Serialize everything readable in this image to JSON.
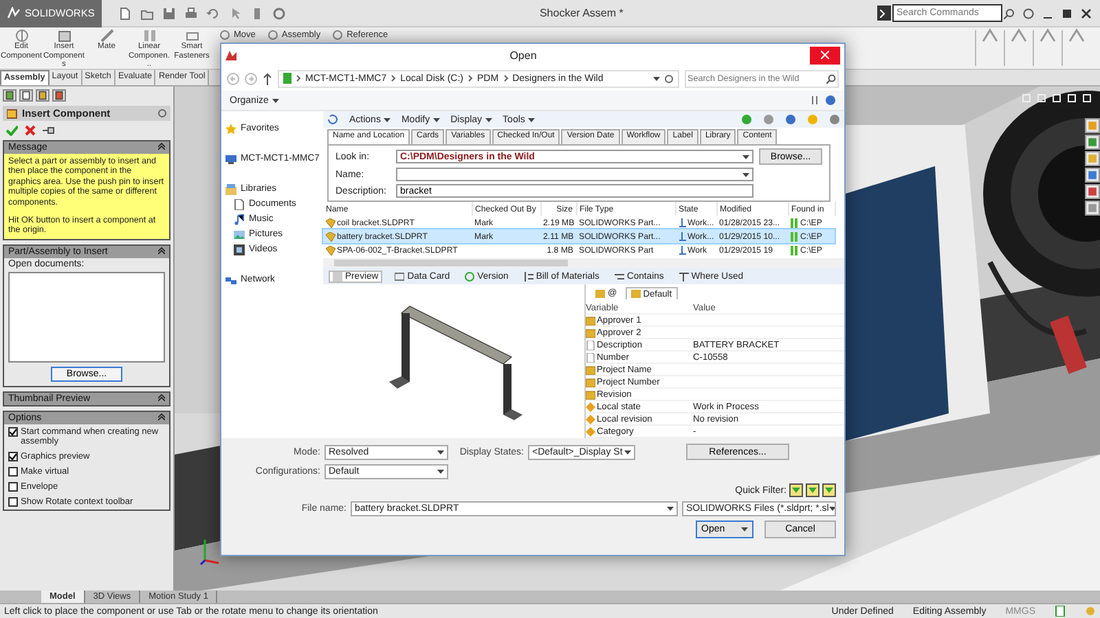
{
  "app": {
    "logo": "SOLIDWORKS",
    "document_title": "Shocker Assem *",
    "search": {
      "placeholder": "Search Commands"
    }
  },
  "ribbon": {
    "buttons": [
      {
        "label": "Edit Component"
      },
      {
        "label": "Insert Components"
      },
      {
        "label": "Mate"
      },
      {
        "label": "Linear Componen..."
      },
      {
        "label": "Smart Fasteners"
      }
    ],
    "top_buttons": [
      {
        "label": "Move"
      },
      {
        "label": "Assembly"
      },
      {
        "label": "Reference"
      }
    ],
    "tabs": [
      {
        "label": "Assembly",
        "selected": true
      },
      {
        "label": "Layout",
        "selected": false
      },
      {
        "label": "Sketch",
        "selected": false
      },
      {
        "label": "Evaluate",
        "selected": false
      },
      {
        "label": "Render Tool",
        "selected": false
      }
    ]
  },
  "property_manager": {
    "title": "Insert Component",
    "message": {
      "title": "Message",
      "paragraphs": [
        "Select a part or assembly to insert and then place the component in the graphics area. Use the push pin to insert multiple copies of the same or different components.",
        "Hit OK button to insert a component at the origin."
      ]
    },
    "part_to_insert": {
      "title": "Part/Assembly to Insert",
      "label": "Open documents:",
      "browse": "Browse..."
    },
    "thumbnail_preview": {
      "title": "Thumbnail Preview"
    },
    "options": {
      "title": "Options",
      "items": [
        {
          "label": "Start command when creating new assembly",
          "checked": true
        },
        {
          "label": "Graphics preview",
          "checked": true
        },
        {
          "label": "Make virtual",
          "checked": false
        },
        {
          "label": "Envelope",
          "checked": false
        },
        {
          "label": "Show Rotate context toolbar",
          "checked": false
        }
      ]
    }
  },
  "bottom_tabs": [
    {
      "label": "Model",
      "selected": true
    },
    {
      "label": "3D Views",
      "selected": false
    },
    {
      "label": "Motion Study 1",
      "selected": false
    }
  ],
  "status_bar": {
    "hint": "Left click to place the component or use Tab or the rotate menu to change its orientation",
    "state": "Under Defined",
    "mode": "Editing Assembly",
    "units": "MMGS"
  },
  "dialog": {
    "title": "Open",
    "path": [
      "MCT-MCT1-MMC7",
      "Local Disk (C:)",
      "PDM",
      "Designers in the Wild"
    ],
    "search": {
      "placeholder": "Search Designers in the Wild"
    },
    "organize": "Organize",
    "nav": [
      {
        "label": "Favorites",
        "kind": "favorites"
      },
      {
        "label": "MCT-MCT1-MMC7",
        "kind": "computer"
      },
      {
        "label": "Libraries",
        "kind": "libraries",
        "children": [
          {
            "label": "Documents",
            "kind": "documents"
          },
          {
            "label": "Music",
            "kind": "music"
          },
          {
            "label": "Pictures",
            "kind": "pictures"
          },
          {
            "label": "Videos",
            "kind": "videos"
          }
        ]
      },
      {
        "label": "Network",
        "kind": "network"
      }
    ],
    "pdm_menu": [
      "Actions",
      "Modify",
      "Display",
      "Tools"
    ],
    "search_tabs": [
      {
        "label": "Name and Location",
        "selected": true
      },
      {
        "label": "Cards",
        "selected": false
      },
      {
        "label": "Variables",
        "selected": false
      },
      {
        "label": "Checked In/Out",
        "selected": false
      },
      {
        "label": "Version Date",
        "selected": false
      },
      {
        "label": "Workflow",
        "selected": false
      },
      {
        "label": "Label",
        "selected": false
      },
      {
        "label": "Library",
        "selected": false
      },
      {
        "label": "Content",
        "selected": false
      }
    ],
    "search_form": {
      "look_in": {
        "label": "Look in:",
        "value": "C:\\PDM\\Designers in the Wild"
      },
      "browse": "Browse...",
      "name": {
        "label": "Name:"
      },
      "description": {
        "label": "Description:",
        "value": "bracket"
      }
    },
    "results": {
      "columns": [
        "Name",
        "Checked Out By",
        "Size",
        "File Type",
        "State",
        "Modified",
        "Found in"
      ],
      "rows": [
        {
          "cells": [
            "coil bracket.SLDPRT",
            "Mark",
            "2.19 MB",
            "SOLIDWORKS Part...",
            "Work...",
            "01/28/2015 23...",
            "C:\\EP"
          ],
          "selected": false
        },
        {
          "cells": [
            "battery bracket.SLDPRT",
            "Mark",
            "2.11 MB",
            "SOLIDWORKS Part...",
            "Work...",
            "01/29/2015 10...",
            "C:\\EP"
          ],
          "selected": true
        },
        {
          "cells": [
            "SPA-06-002_T-Bracket.SLDPRT",
            "",
            "1.8 MB",
            "SOLIDWORKS Part",
            "Work",
            "01/29/2015 19",
            "C:\\EP"
          ],
          "selected": false
        }
      ]
    },
    "preview_tabs": [
      {
        "label": "Preview",
        "selected": true
      },
      {
        "label": "Data Card",
        "selected": false
      },
      {
        "label": "Version",
        "selected": false
      },
      {
        "label": "Bill of Materials",
        "selected": false
      },
      {
        "label": "Contains",
        "selected": false
      },
      {
        "label": "Where Used",
        "selected": false
      }
    ],
    "card_tabs": [
      {
        "label": "@",
        "selected": false
      },
      {
        "label": "Default",
        "selected": true
      }
    ],
    "properties": {
      "columns": [
        "Variable",
        "Value"
      ],
      "rows": [
        {
          "variable": "Approver 1",
          "kind": "card"
        },
        {
          "variable": "Approver 2",
          "kind": "card"
        },
        {
          "variable": "Description",
          "value": "BATTERY BRACKET",
          "kind": "doc"
        },
        {
          "variable": "Number",
          "value": "C-10558",
          "kind": "doc"
        },
        {
          "variable": "Project Name",
          "kind": "card"
        },
        {
          "variable": "Project Number",
          "kind": "card"
        },
        {
          "variable": "Revision",
          "kind": "card"
        },
        {
          "variable": "Local state",
          "value": "Work in Process",
          "kind": "state"
        },
        {
          "variable": "Local revision",
          "value": "No revision",
          "kind": "state"
        },
        {
          "variable": "Category",
          "value": "-",
          "kind": "state"
        }
      ]
    },
    "footer": {
      "mode": {
        "label": "Mode:",
        "value": "Resolved"
      },
      "display_states": {
        "label": "Display States:",
        "value": "<Default>_Display St"
      },
      "references": "References...",
      "configurations": {
        "label": "Configurations:",
        "value": "Default"
      },
      "quick_filter": "Quick Filter:",
      "file_name": {
        "label": "File name:",
        "value": "battery bracket.SLDPRT"
      },
      "file_type": "SOLIDWORKS Files (*.sldprt; *.sl",
      "open": "Open",
      "cancel": "Cancel"
    }
  }
}
